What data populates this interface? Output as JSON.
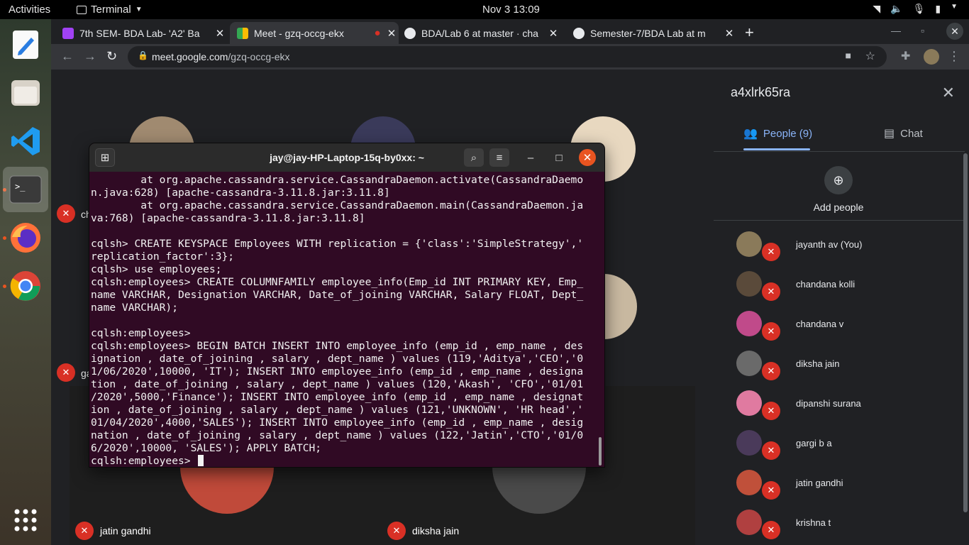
{
  "topbar": {
    "activities": "Activities",
    "app_name": "Terminal",
    "clock": "Nov 3  13:09"
  },
  "browser": {
    "tabs": [
      {
        "title": "7th SEM- BDA Lab- 'A2' Ba",
        "color": "#a142f4"
      },
      {
        "title": "Meet - gzq-occg-ekx",
        "color": "#34a853"
      },
      {
        "title": "",
        "color": "#d93025"
      },
      {
        "title": "BDA/Lab 6 at master · cha",
        "color": "#e8eaed"
      },
      {
        "title": "Semester-7/BDA Lab at m",
        "color": "#e8eaed"
      }
    ],
    "url_host": "meet.google.com",
    "url_path": "/gzq-occg-ekx"
  },
  "meet": {
    "tile_names": {
      "left_top_partial": "ch",
      "left_mid_partial": "ga",
      "bottom_left": "jatin gandhi",
      "bottom_right": "diksha jain"
    }
  },
  "panel": {
    "meeting_code": "a4xlrk65ra",
    "people_tab": "People (9)",
    "chat_tab": "Chat",
    "add_people": "Add people",
    "participants": [
      {
        "name": "jayanth av (You)",
        "color": "#8a7a5a"
      },
      {
        "name": "chandana kolli",
        "color": "#5a4a3a"
      },
      {
        "name": "chandana v",
        "color": "#c04a8a"
      },
      {
        "name": "diksha jain",
        "color": "#6a6a6a"
      },
      {
        "name": "dipanshi surana",
        "color": "#e07aa0"
      },
      {
        "name": "gargi b a",
        "color": "#4a3a5a"
      },
      {
        "name": "jatin gandhi",
        "color": "#c0503a"
      },
      {
        "name": "krishna t",
        "color": "#b04040"
      }
    ]
  },
  "terminal": {
    "title": "jay@jay-HP-Laptop-15q-by0xx: ~",
    "lines": [
      "        at org.apache.cassandra.service.CassandraDaemon.activate(CassandraDaemo",
      "n.java:628) [apache-cassandra-3.11.8.jar:3.11.8]",
      "        at org.apache.cassandra.service.CassandraDaemon.main(CassandraDaemon.ja",
      "va:768) [apache-cassandra-3.11.8.jar:3.11.8]",
      "",
      "cqlsh> CREATE KEYSPACE Employees WITH replication = {'class':'SimpleStrategy','",
      "replication_factor':3};",
      "cqlsh> use employees;",
      "cqlsh:employees> CREATE COLUMNFAMILY employee_info(Emp_id INT PRIMARY KEY, Emp_",
      "name VARCHAR, Designation VARCHAR, Date_of_joining VARCHAR, Salary FLOAT, Dept_",
      "name VARCHAR);",
      "",
      "cqlsh:employees>",
      "cqlsh:employees> BEGIN BATCH INSERT INTO employee_info (emp_id , emp_name , des",
      "ignation , date_of_joining , salary , dept_name ) values (119,'Aditya','CEO','0",
      "1/06/2020',10000, 'IT'); INSERT INTO employee_info (emp_id , emp_name , designa",
      "tion , date_of_joining , salary , dept_name ) values (120,'Akash', 'CFO','01/01",
      "/2020',5000,'Finance'); INSERT INTO employee_info (emp_id , emp_name , designat",
      "ion , date_of_joining , salary , dept_name ) values (121,'UNKNOWN', 'HR head','",
      "01/04/2020',4000,'SALES'); INSERT INTO employee_info (emp_id , emp_name , desig",
      "nation , date_of_joining , salary , dept_name ) values (122,'Jatin','CTO','01/0",
      "6/2020',10000, 'SALES'); APPLY BATCH;"
    ],
    "prompt": "cqlsh:employees> "
  }
}
